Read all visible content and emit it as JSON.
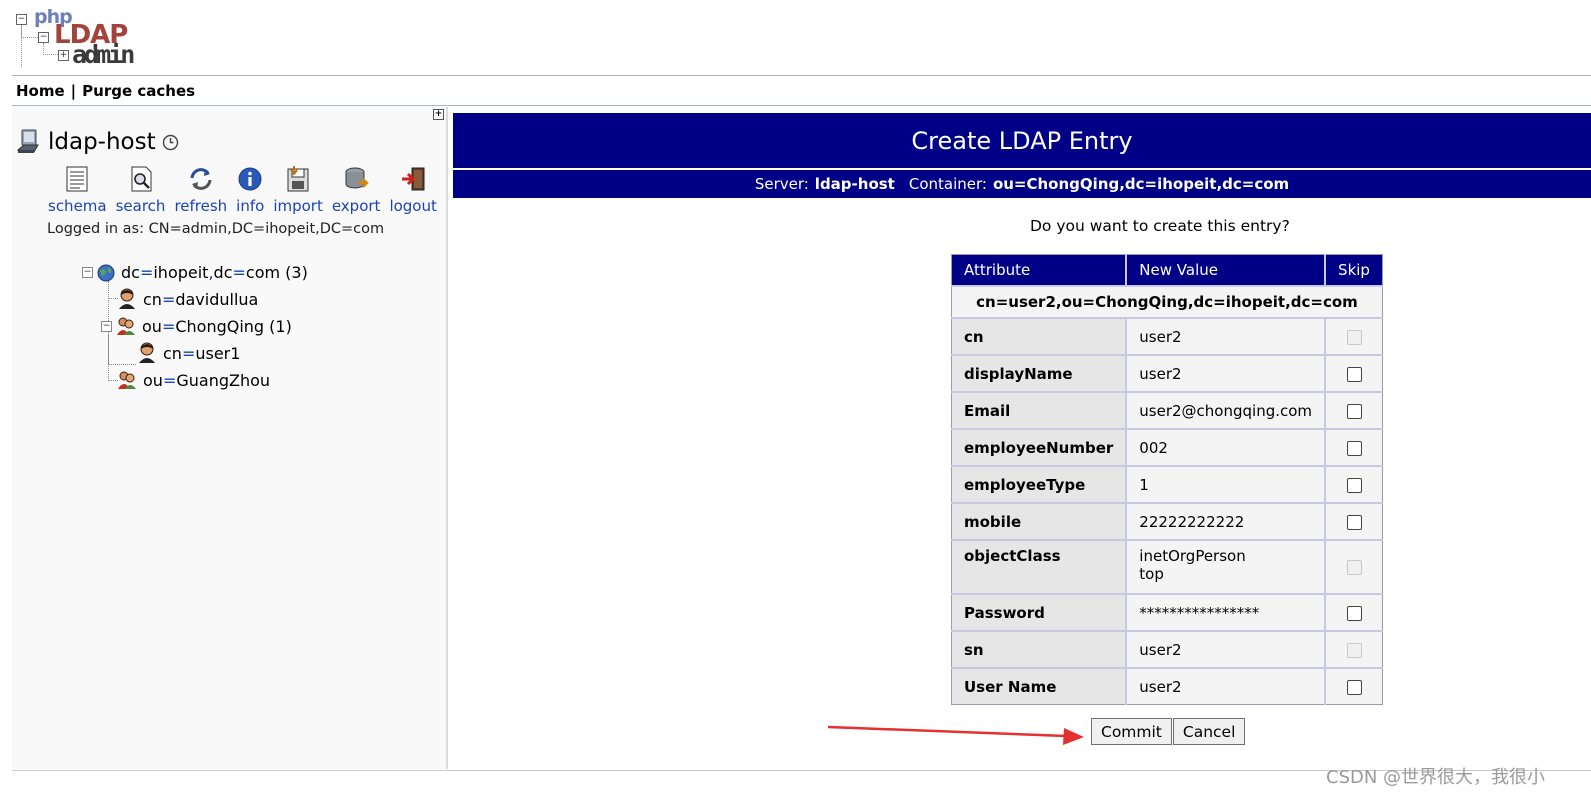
{
  "logo": {
    "php": "php",
    "ldap": "LDAP",
    "admin": "admin"
  },
  "nav": {
    "home": "Home",
    "separator": "|",
    "purge": "Purge caches"
  },
  "server": {
    "name": "ldap-host",
    "actions": [
      {
        "label": "schema",
        "icon": "schema-icon"
      },
      {
        "label": "search",
        "icon": "search-icon"
      },
      {
        "label": "refresh",
        "icon": "refresh-icon"
      },
      {
        "label": "info",
        "icon": "info-icon"
      },
      {
        "label": "import",
        "icon": "import-icon"
      },
      {
        "label": "export",
        "icon": "export-icon"
      },
      {
        "label": "logout",
        "icon": "logout-icon"
      }
    ],
    "logged_in": "Logged in as: CN=admin,DC=ihopeit,DC=com"
  },
  "tree": {
    "root": {
      "attr": "dc",
      "value": "ihopeit",
      "attr2": "dc",
      "value2": "com",
      "count": "(3)"
    },
    "n1": {
      "attr": "cn",
      "value": "davidullua"
    },
    "n2": {
      "attr": "ou",
      "value": "ChongQing",
      "count": "(1)"
    },
    "n3": {
      "attr": "cn",
      "value": "user1"
    },
    "n4": {
      "attr": "ou",
      "value": "GuangZhou"
    }
  },
  "main": {
    "title": "Create LDAP Entry",
    "server_label": "Server:",
    "server_value": "ldap-host",
    "container_label": "Container:",
    "container_value": "ou=ChongQing,dc=ihopeit,dc=com",
    "question": "Do you want to create this entry?",
    "columns": [
      "Attribute",
      "New Value",
      "Skip"
    ],
    "dn": "cn=user2,ou=ChongQing,dc=ihopeit,dc=com",
    "rows": [
      {
        "attr": "cn",
        "value": "user2",
        "skip_disabled": true
      },
      {
        "attr": "displayName",
        "value": "user2",
        "skip_disabled": false
      },
      {
        "attr": "Email",
        "value": "user2@chongqing.com",
        "skip_disabled": false
      },
      {
        "attr": "employeeNumber",
        "value": "002",
        "skip_disabled": false
      },
      {
        "attr": "employeeType",
        "value": "1",
        "skip_disabled": false
      },
      {
        "attr": "mobile",
        "value": "22222222222",
        "skip_disabled": false
      },
      {
        "attr": "objectClass",
        "value": "inetOrgPerson",
        "value2": "top",
        "skip_disabled": true
      },
      {
        "attr": "Password",
        "value": "****************",
        "skip_disabled": false
      },
      {
        "attr": "sn",
        "value": "user2",
        "skip_disabled": true
      },
      {
        "attr": "User Name",
        "value": "user2",
        "skip_disabled": false
      }
    ],
    "commit": "Commit",
    "cancel": "Cancel"
  },
  "watermark": "CSDN @世界很大，我很小",
  "colors": {
    "header_bg": "#000087",
    "link": "#1a44b8",
    "arrow": "#e53030"
  }
}
